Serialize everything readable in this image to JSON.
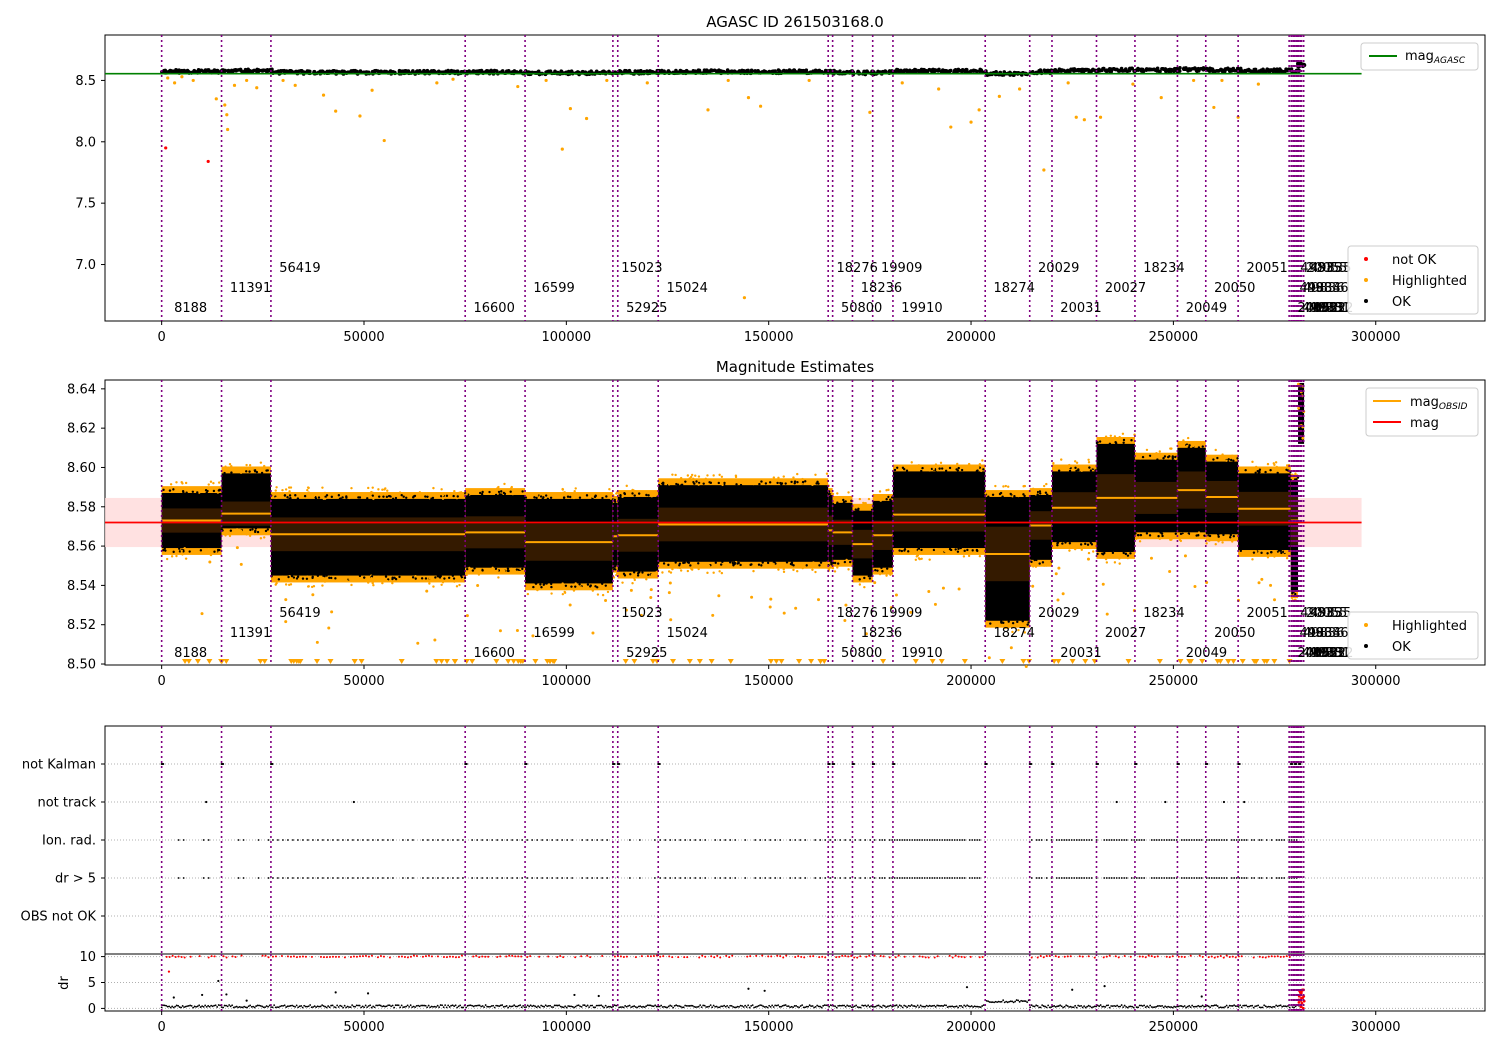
{
  "chart_data": [
    {
      "type": "scatter",
      "title": "AGASC ID 261503168.0",
      "xlim": [
        -14000,
        327000
      ],
      "ylim": [
        6.54,
        8.87
      ],
      "xticks": [
        0,
        50000,
        100000,
        150000,
        200000,
        250000,
        300000
      ],
      "xtick_labels": [
        "0",
        "50000",
        "100000",
        "150000",
        "200000",
        "250000",
        "300000"
      ],
      "yticks": [
        7.0,
        7.5,
        8.0,
        8.5
      ],
      "ytick_labels": [
        "7.0",
        "7.5",
        "8.0",
        "8.5"
      ],
      "agasc_mag": 8.555,
      "agasc_line_xrange": [
        -14000,
        296500
      ],
      "band": {
        "ok_low": 8.557,
        "ok_high": 8.595
      },
      "highlighted_points": [
        {
          "x": 1500,
          "y": 8.52
        },
        {
          "x": 3200,
          "y": 8.48
        },
        {
          "x": 5000,
          "y": 8.53
        },
        {
          "x": 7800,
          "y": 8.5
        },
        {
          "x": 13500,
          "y": 8.35
        },
        {
          "x": 15600,
          "y": 8.3
        },
        {
          "x": 16100,
          "y": 8.22
        },
        {
          "x": 16300,
          "y": 8.1
        },
        {
          "x": 18000,
          "y": 8.46
        },
        {
          "x": 21000,
          "y": 8.5
        },
        {
          "x": 23500,
          "y": 8.44
        },
        {
          "x": 30000,
          "y": 8.5
        },
        {
          "x": 33000,
          "y": 8.46
        },
        {
          "x": 40000,
          "y": 8.38
        },
        {
          "x": 43000,
          "y": 8.25
        },
        {
          "x": 49000,
          "y": 8.21
        },
        {
          "x": 52000,
          "y": 8.42
        },
        {
          "x": 55000,
          "y": 8.01
        },
        {
          "x": 68000,
          "y": 8.48
        },
        {
          "x": 72000,
          "y": 8.51
        },
        {
          "x": 88000,
          "y": 8.45
        },
        {
          "x": 95000,
          "y": 8.5
        },
        {
          "x": 99000,
          "y": 7.94
        },
        {
          "x": 101000,
          "y": 8.27
        },
        {
          "x": 105000,
          "y": 8.19
        },
        {
          "x": 110000,
          "y": 8.5
        },
        {
          "x": 120000,
          "y": 8.48
        },
        {
          "x": 135000,
          "y": 8.26
        },
        {
          "x": 140000,
          "y": 8.5
        },
        {
          "x": 145000,
          "y": 8.36
        },
        {
          "x": 148000,
          "y": 8.29
        },
        {
          "x": 160000,
          "y": 8.5
        },
        {
          "x": 175000,
          "y": 8.24
        },
        {
          "x": 183000,
          "y": 8.48
        },
        {
          "x": 192000,
          "y": 8.43
        },
        {
          "x": 195000,
          "y": 8.12
        },
        {
          "x": 200000,
          "y": 8.16
        },
        {
          "x": 202000,
          "y": 8.26
        },
        {
          "x": 207000,
          "y": 8.37
        },
        {
          "x": 212000,
          "y": 8.43
        },
        {
          "x": 218000,
          "y": 7.77
        },
        {
          "x": 224000,
          "y": 8.48
        },
        {
          "x": 226000,
          "y": 8.2
        },
        {
          "x": 228000,
          "y": 8.18
        },
        {
          "x": 232000,
          "y": 8.2
        },
        {
          "x": 240000,
          "y": 8.47
        },
        {
          "x": 247000,
          "y": 8.36
        },
        {
          "x": 255000,
          "y": 8.5
        },
        {
          "x": 260000,
          "y": 8.28
        },
        {
          "x": 262000,
          "y": 8.5
        },
        {
          "x": 266000,
          "y": 8.2
        },
        {
          "x": 271000,
          "y": 8.47
        },
        {
          "x": 144000,
          "y": 6.73
        }
      ],
      "not_ok_points": [
        {
          "x": 1000,
          "y": 7.95
        },
        {
          "x": 11500,
          "y": 7.84
        }
      ],
      "legend_lines": [
        "mag_AGASC"
      ],
      "legend_markers": [
        "not OK",
        "Highlighted",
        "OK"
      ]
    },
    {
      "type": "scatter",
      "title": "Magnitude Estimates",
      "xlim": [
        -14000,
        327000
      ],
      "ylim": [
        8.4995,
        8.6445
      ],
      "xticks": [
        0,
        50000,
        100000,
        150000,
        200000,
        250000,
        300000
      ],
      "xtick_labels": [
        "0",
        "50000",
        "100000",
        "150000",
        "200000",
        "250000",
        "300000"
      ],
      "yticks": [
        8.5,
        8.52,
        8.54,
        8.56,
        8.58,
        8.6,
        8.62,
        8.64
      ],
      "ytick_labels": [
        "8.50",
        "8.52",
        "8.54",
        "8.56",
        "8.58",
        "8.60",
        "8.62",
        "8.64"
      ],
      "mag": 8.572,
      "mag_band": [
        8.5595,
        8.5845
      ],
      "mag_line_xrange": [
        -14000,
        296500
      ],
      "segments": [
        {
          "x0": 0,
          "x1": 14800,
          "lo": 8.559,
          "hi": 8.587,
          "mean": 8.573
        },
        {
          "x0": 14800,
          "x1": 27000,
          "lo": 8.569,
          "hi": 8.597,
          "mean": 8.5765
        },
        {
          "x0": 27000,
          "x1": 75000,
          "lo": 8.545,
          "hi": 8.584,
          "mean": 8.566
        },
        {
          "x0": 75000,
          "x1": 89800,
          "lo": 8.549,
          "hi": 8.586,
          "mean": 8.567
        },
        {
          "x0": 89800,
          "x1": 111500,
          "lo": 8.541,
          "hi": 8.584,
          "mean": 8.562
        },
        {
          "x0": 111500,
          "x1": 112700,
          "lo": 8.55,
          "hi": 8.582,
          "mean": 8.565
        },
        {
          "x0": 112700,
          "x1": 122700,
          "lo": 8.547,
          "hi": 8.585,
          "mean": 8.5655
        },
        {
          "x0": 122700,
          "x1": 164700,
          "lo": 8.552,
          "hi": 8.591,
          "mean": 8.571
        },
        {
          "x0": 164700,
          "x1": 165800,
          "lo": 8.552,
          "hi": 8.586,
          "mean": 8.568
        },
        {
          "x0": 165800,
          "x1": 170700,
          "lo": 8.553,
          "hi": 8.582,
          "mean": 8.567
        },
        {
          "x0": 170700,
          "x1": 175700,
          "lo": 8.545,
          "hi": 8.578,
          "mean": 8.561
        },
        {
          "x0": 175700,
          "x1": 180700,
          "lo": 8.549,
          "hi": 8.583,
          "mean": 8.5655
        },
        {
          "x0": 180700,
          "x1": 203500,
          "lo": 8.559,
          "hi": 8.598,
          "mean": 8.576
        },
        {
          "x0": 203500,
          "x1": 214500,
          "lo": 8.522,
          "hi": 8.585,
          "mean": 8.556
        },
        {
          "x0": 214500,
          "x1": 220000,
          "lo": 8.553,
          "hi": 8.586,
          "mean": 8.5705
        },
        {
          "x0": 220000,
          "x1": 231000,
          "lo": 8.562,
          "hi": 8.598,
          "mean": 8.5795
        },
        {
          "x0": 231000,
          "x1": 240500,
          "lo": 8.557,
          "hi": 8.612,
          "mean": 8.5845
        },
        {
          "x0": 240500,
          "x1": 251000,
          "lo": 8.567,
          "hi": 8.604,
          "mean": 8.5845
        },
        {
          "x0": 251000,
          "x1": 258000,
          "lo": 8.567,
          "hi": 8.61,
          "mean": 8.5885
        },
        {
          "x0": 258000,
          "x1": 266000,
          "lo": 8.566,
          "hi": 8.603,
          "mean": 8.585
        },
        {
          "x0": 266000,
          "x1": 279000,
          "lo": 8.558,
          "hi": 8.597,
          "mean": 8.579
        },
        {
          "x0": 279000,
          "x1": 280800,
          "lo": 8.537,
          "hi": 8.593,
          "mean": 8.573
        }
      ],
      "tail": {
        "x0": 280800,
        "x1": 282300,
        "lo": 8.612,
        "hi": 8.643
      },
      "legend_lines": [
        "mag_OBSID",
        "mag"
      ],
      "legend_markers": [
        "Highlighted",
        "OK"
      ]
    },
    {
      "type": "scatter",
      "title": "",
      "xlim": [
        -14000,
        327000
      ],
      "categories": [
        "not Kalman",
        "not track",
        "Ion. rad.",
        "dr > 5",
        "OBS not OK"
      ],
      "flags": {
        "not Kalman": [
          0,
          14800,
          27000,
          75000,
          89800,
          111500,
          112700,
          122700,
          164700,
          165800,
          170700,
          175700,
          180700,
          203500,
          214500,
          220000,
          231000,
          240500,
          251000,
          258000,
          266000,
          279000,
          280000,
          281000
        ],
        "not track": [
          11000,
          47500,
          236000,
          248000,
          262500,
          267500
        ]
      },
      "dense_ranges": [
        [
          0,
          14800
        ],
        [
          14800,
          27000
        ],
        [
          27000,
          75000
        ],
        [
          75000,
          111500
        ],
        [
          111500,
          122700
        ],
        [
          122700,
          164700
        ],
        [
          164700,
          175700
        ],
        [
          175700,
          203500
        ],
        [
          214500,
          281000
        ]
      ]
    },
    {
      "type": "scatter",
      "title": "",
      "ylabel": "dr",
      "xlim": [
        -14000,
        327000
      ],
      "ylim": [
        -0.5,
        10.5
      ],
      "yticks": [
        0,
        5,
        10
      ],
      "ytick_labels": [
        "0",
        "5",
        "10"
      ],
      "clipped_value": 10,
      "outliers": [
        {
          "x": 3000,
          "y": 2.1
        },
        {
          "x": 10000,
          "y": 2.6
        },
        {
          "x": 14000,
          "y": 5.3
        },
        {
          "x": 16000,
          "y": 2.7
        },
        {
          "x": 21000,
          "y": 1.5
        },
        {
          "x": 43000,
          "y": 3.1
        },
        {
          "x": 51000,
          "y": 2.9
        },
        {
          "x": 102000,
          "y": 2.6
        },
        {
          "x": 108000,
          "y": 2.4
        },
        {
          "x": 145000,
          "y": 3.8
        },
        {
          "x": 149000,
          "y": 3.4
        },
        {
          "x": 199000,
          "y": 4.1
        },
        {
          "x": 225000,
          "y": 3.6
        },
        {
          "x": 233000,
          "y": 4.3
        },
        {
          "x": 257000,
          "y": 2.3
        }
      ],
      "red_outliers": [
        {
          "x": 1800,
          "y": 7.1
        }
      ]
    }
  ],
  "obsids": [
    {
      "x": 0,
      "label": "8188",
      "row": 3
    },
    {
      "x": 14800,
      "label": "11391",
      "row": 2
    },
    {
      "x": 27000,
      "label": "56419",
      "row": 1
    },
    {
      "x": 75000,
      "label": "16600",
      "row": 3
    },
    {
      "x": 89800,
      "label": "16599",
      "row": 2
    },
    {
      "x": 111500,
      "label": "15023",
      "row": 1
    },
    {
      "x": 112700,
      "label": "52925",
      "row": 3
    },
    {
      "x": 122700,
      "label": "15024",
      "row": 2
    },
    {
      "x": 164700,
      "label": "18276",
      "row": 1
    },
    {
      "x": 165800,
      "label": "50800",
      "row": 3
    },
    {
      "x": 170700,
      "label": "18236",
      "row": 2
    },
    {
      "x": 175700,
      "label": "19909",
      "row": 1
    },
    {
      "x": 180700,
      "label": "19910",
      "row": 3
    },
    {
      "x": 203500,
      "label": "18274",
      "row": 2
    },
    {
      "x": 214500,
      "label": "20029",
      "row": 1
    },
    {
      "x": 220000,
      "label": "20031",
      "row": 3
    },
    {
      "x": 231000,
      "label": "20027",
      "row": 2
    },
    {
      "x": 240500,
      "label": "18234",
      "row": 1
    },
    {
      "x": 251000,
      "label": "20049",
      "row": 3
    },
    {
      "x": 258000,
      "label": "20050",
      "row": 2
    },
    {
      "x": 266000,
      "label": "20051",
      "row": 1
    },
    {
      "x": 278600,
      "label": "20052",
      "row": 3
    },
    {
      "x": 279100,
      "label": "49834",
      "row": 2
    },
    {
      "x": 279300,
      "label": "49835",
      "row": 1
    },
    {
      "x": 279700,
      "label": "49833",
      "row": 3
    },
    {
      "x": 280000,
      "label": "49836",
      "row": 2
    },
    {
      "x": 280400,
      "label": "49832",
      "row": 3
    },
    {
      "x": 280700,
      "label": "20055",
      "row": 1
    },
    {
      "x": 281000,
      "label": "49836",
      "row": 2
    },
    {
      "x": 281400,
      "label": "49831",
      "row": 3
    },
    {
      "x": 281700,
      "label": "49835",
      "row": 1
    },
    {
      "x": 282200,
      "label": "49832",
      "row": 3
    }
  ],
  "colors": {
    "ok": "#000000",
    "highlighted": "#ffa500",
    "not_ok": "#ff0000",
    "agasc_line": "#008000",
    "obsid_line": "#ffa500",
    "mag_line": "#ff0000",
    "mag_band": "#ffdada",
    "obsid_marker": "#800080",
    "segment_fill": "#3a1d00"
  },
  "legends": {
    "top_lines": [
      {
        "label": "mag",
        "sub": "AGASC",
        "color": "#008000"
      }
    ],
    "top_markers": [
      {
        "label": "not OK",
        "color": "#ff0000"
      },
      {
        "label": "Highlighted",
        "color": "#ffa500"
      },
      {
        "label": "OK",
        "color": "#000000"
      }
    ],
    "mid_lines": [
      {
        "label": "mag",
        "sub": "OBSID",
        "color": "#ffa500"
      },
      {
        "label": "mag",
        "sub": "",
        "color": "#ff0000"
      }
    ],
    "mid_markers": [
      {
        "label": "Highlighted",
        "color": "#ffa500"
      },
      {
        "label": "OK",
        "color": "#000000"
      }
    ]
  }
}
